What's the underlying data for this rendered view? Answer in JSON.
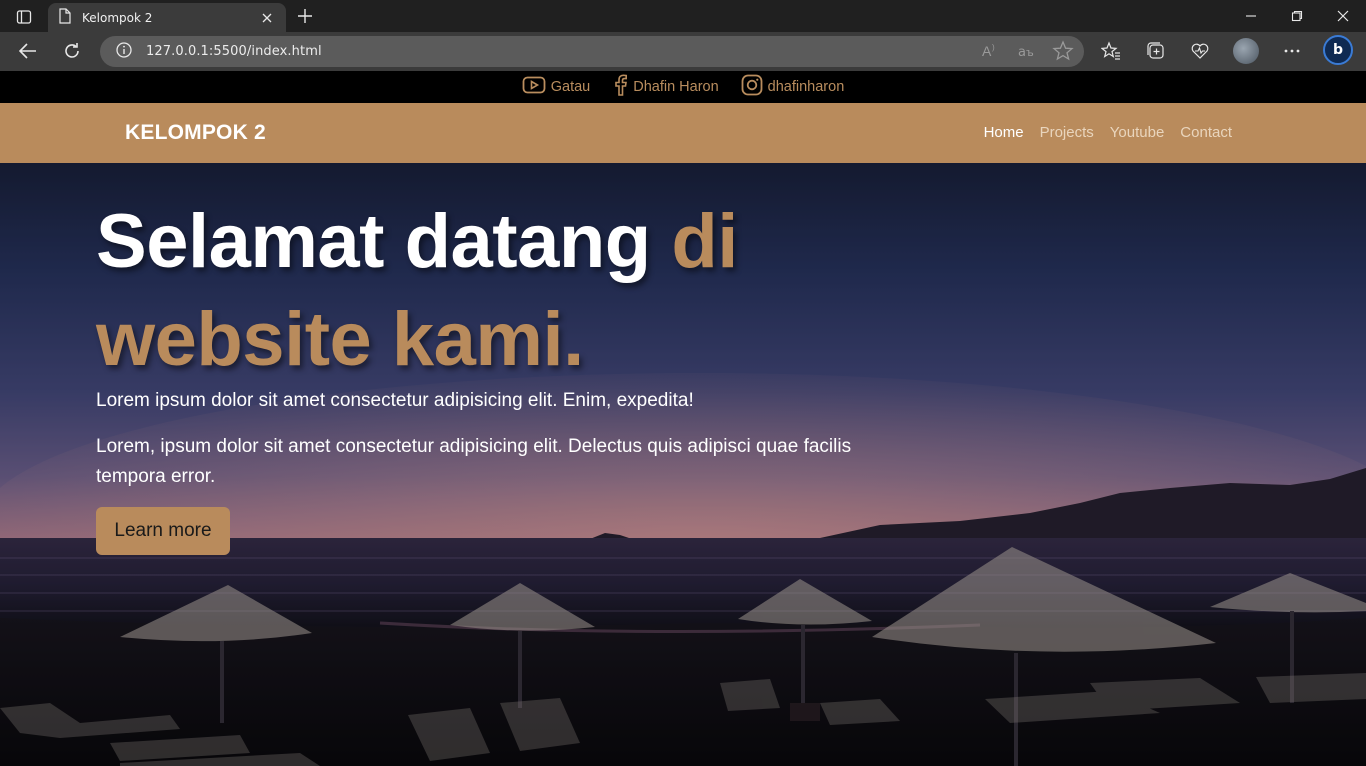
{
  "browser": {
    "tab_title": "Kelompok 2",
    "url": "127.0.0.1:5500/index.html",
    "icons": [
      "sidebar-icon",
      "page-icon",
      "close-icon",
      "plus-icon",
      "minimize-icon",
      "restore-icon",
      "close-window-icon",
      "back-icon",
      "reload-icon",
      "info-icon",
      "read-aloud-icon",
      "translate-icon",
      "favorite-star-icon",
      "favorites-icon",
      "collections-icon",
      "health-icon",
      "profile-avatar",
      "more-icon",
      "copilot-icon"
    ]
  },
  "topbar": {
    "items": [
      {
        "icon": "youtube-icon",
        "label": "Gatau"
      },
      {
        "icon": "facebook-icon",
        "label": "Dhafin Haron"
      },
      {
        "icon": "instagram-icon",
        "label": "dhafinharon"
      }
    ],
    "color": "#b98d5e"
  },
  "navbar": {
    "brand": "KELOMPOK 2",
    "links": [
      "Home",
      "Projects",
      "Youtube",
      "Contact"
    ],
    "active": "Home",
    "background": "#b98b5c"
  },
  "hero": {
    "headline_white": "Selamat datang ",
    "headline_accent_1": "di",
    "headline_accent_2": "website kami.",
    "paragraph_1": "Lorem ipsum dolor sit amet consectetur adipisicing elit. Enim, expedita!",
    "paragraph_2": "Lorem, ipsum dolor sit amet consectetur adipisicing elit. Delectus quis adipisci quae facilis tempora error.",
    "button_label": "Learn more",
    "accent_color": "#b98b5c"
  }
}
